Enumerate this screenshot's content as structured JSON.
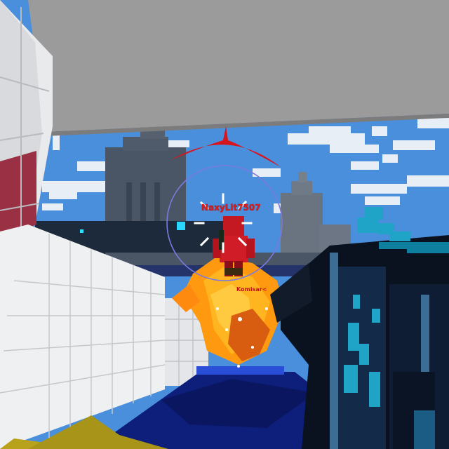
{
  "hud": {
    "enemy_nameplate": "NaxyLit7507",
    "enemy_nameplate_2": "Komisar<",
    "indicator_color": "#d8141c",
    "crosshair_color": "#ffffff",
    "scope_ring_color": "#7a7ae0"
  },
  "scene": {
    "sky_color": "#4c90de",
    "cloud_color": "#e8eef6",
    "explosion_color": "#ff9a10",
    "enemy_color": "#c41822"
  },
  "weapon": {
    "icon": "blaster-rifle-icon",
    "primary_color": "#0a1220",
    "accent_color": "#1fa3c7"
  }
}
